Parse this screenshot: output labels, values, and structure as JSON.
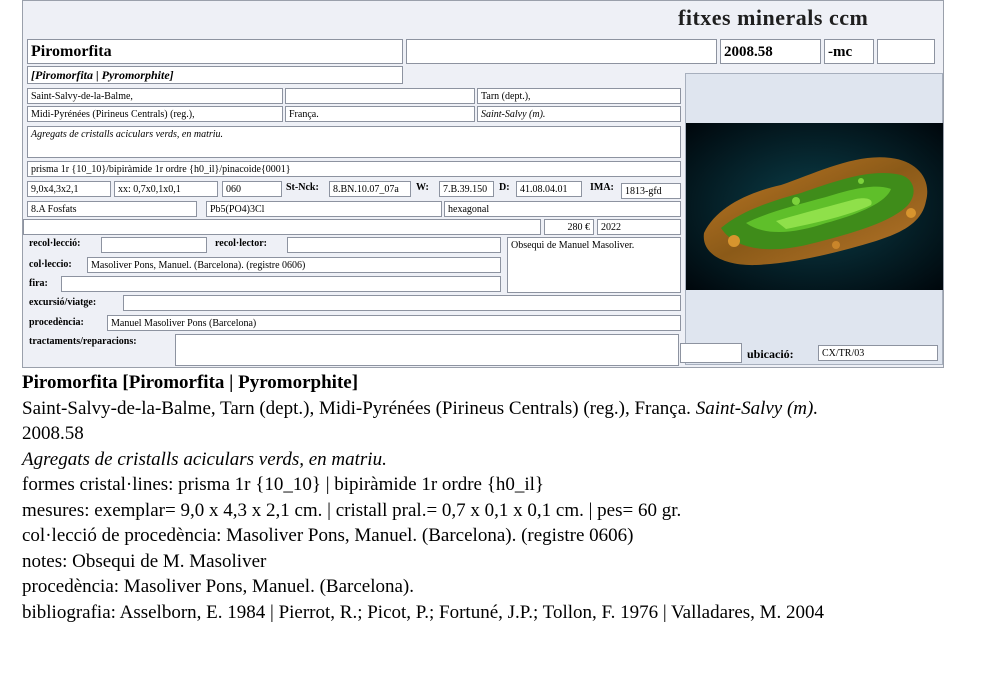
{
  "card": {
    "title": "fitxes minerals ccm",
    "name": "Piromorfita",
    "blank1": "",
    "code": "2008.58",
    "suffix": "-mc",
    "blank2": "",
    "species": "[Piromorfita | Pyromorphite]",
    "locality": "Saint-Salvy-de-la-Balme,",
    "loc_blank": "",
    "dept": "Tarn (dept.),",
    "region": "Midi-Pyrénées (Pirineus Centrals) (reg.),",
    "country": "França.",
    "mine": "Saint-Salvy (m).",
    "description": "Agregats de cristalls aciculars verds, en matriu.",
    "forms": "prisma 1r {10_10}/bipiràmide 1r ordre {h0_il}/pinacoide{0001}",
    "size": "9,0x4,3x2,1",
    "xx": "xx: 0,7x0,1x0,1",
    "weight": "060",
    "stnck_label": "St-Nck:",
    "stnck": "8.BN.10.07_07a",
    "w_label": "W:",
    "w": "7.B.39.150",
    "d_label": "D:",
    "d": "41.08.04.01",
    "ima_label": "IMA:",
    "ima": "1813-gfd",
    "class": "8.A Fosfats",
    "formula": "Pb5(PO4)3Cl",
    "system": "hexagonal",
    "price": "280 €",
    "year": "2022",
    "recol_label": "recol·lecció:",
    "recol": "",
    "recolector_label": "recol·lector:",
    "recolector": "",
    "notes": "Obsequi de Manuel Masoliver.",
    "colleccio_label": "col·leccio:",
    "colleccio": "Masoliver Pons, Manuel. (Barcelona). (registre 0606)",
    "fira_label": "fira:",
    "fira": "",
    "excursio_label": "excursió/viatge:",
    "excursio": "",
    "procedencia_label": "procedència:",
    "procedencia": "Manuel Masoliver Pons (Barcelona)",
    "tractaments_label": "tractaments/reparacions:",
    "tractaments": "",
    "ubicacio_label": "ubicació:",
    "ubicacio": "CX/TR/03",
    "ubic_blank": ""
  },
  "summary": {
    "line1": "Piromorfita [Piromorfita | Pyromorphite]",
    "line2a": "Saint-Salvy-de-la-Balme, Tarn (dept.), Midi-Pyrénées (Pirineus Centrals) (reg.), França. ",
    "line2b": "Saint-Salvy (m).",
    "line3": "2008.58",
    "line4": "Agregats de cristalls aciculars verds, en matriu.",
    "line5": "formes cristal·lines: prisma 1r {10_10} | bipiràmide 1r ordre {h0_il}",
    "line6": "mesures: exemplar= 9,0 x 4,3 x 2,1 cm. | cristall pral.= 0,7 x 0,1 x 0,1 cm. | pes= 60 gr.",
    "line7": "col·lecció de procedència: Masoliver Pons, Manuel. (Barcelona). (registre 0606)",
    "line8": "notes: Obsequi de M. Masoliver",
    "line9": "procedència: Masoliver Pons, Manuel. (Barcelona).",
    "line10": "bibliografia: Asselborn, E. 1984 | Pierrot, R.; Picot, P.; Fortuné, J.P.; Tollon, F. 1976 | Valladares, M. 2004"
  }
}
